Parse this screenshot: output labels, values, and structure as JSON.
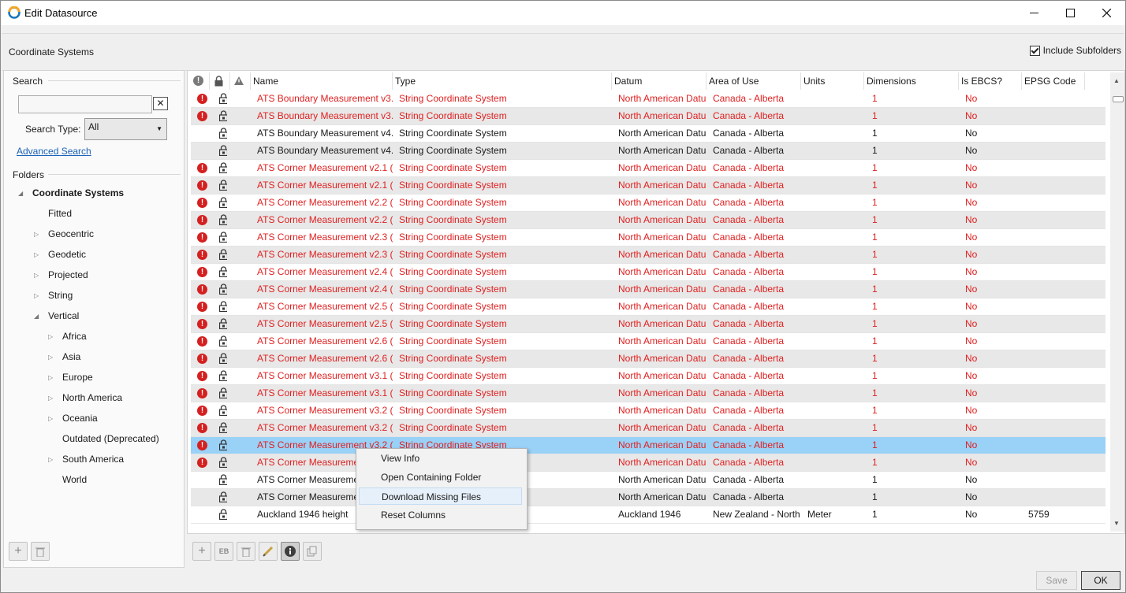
{
  "window": {
    "title": "Edit Datasource"
  },
  "header": {
    "section_title": "Coordinate Systems",
    "include_subfolders": "Include Subfolders",
    "include_subfolders_checked": true
  },
  "search": {
    "label": "Search",
    "type_label": "Search Type:",
    "type_value": "All",
    "advanced": "Advanced Search",
    "clear": "✕"
  },
  "folders": {
    "label": "Folders",
    "items": [
      {
        "label": "Coordinate Systems",
        "level": 0,
        "expander": "open",
        "bold": true
      },
      {
        "label": "Fitted",
        "level": 1,
        "expander": "none"
      },
      {
        "label": "Geocentric",
        "level": 1,
        "expander": "closed"
      },
      {
        "label": "Geodetic",
        "level": 1,
        "expander": "closed"
      },
      {
        "label": "Projected",
        "level": 1,
        "expander": "closed"
      },
      {
        "label": "String",
        "level": 1,
        "expander": "closed"
      },
      {
        "label": "Vertical",
        "level": 1,
        "expander": "open"
      },
      {
        "label": "Africa",
        "level": 2,
        "expander": "closed"
      },
      {
        "label": "Asia",
        "level": 2,
        "expander": "closed"
      },
      {
        "label": "Europe",
        "level": 2,
        "expander": "closed"
      },
      {
        "label": "North America",
        "level": 2,
        "expander": "closed"
      },
      {
        "label": "Oceania",
        "level": 2,
        "expander": "closed"
      },
      {
        "label": "Outdated (Deprecated)",
        "level": 2,
        "expander": "none"
      },
      {
        "label": "South America",
        "level": 2,
        "expander": "closed"
      },
      {
        "label": "World",
        "level": 2,
        "expander": "none"
      }
    ]
  },
  "grid": {
    "columns": [
      "Name",
      "Type",
      "Datum",
      "Area of Use",
      "Units",
      "Dimensions",
      "Is EBCS?",
      "EPSG Code"
    ],
    "rows": [
      {
        "err": true,
        "name": "ATS Boundary Measurement v3.",
        "type": "String Coordinate System",
        "datum": "North American Datu",
        "area": "Canada - Alberta",
        "units": "",
        "dims": "1",
        "ebcs": "No",
        "epsg": ""
      },
      {
        "err": true,
        "name": "ATS Boundary Measurement v3.",
        "type": "String Coordinate System",
        "datum": "North American Datu",
        "area": "Canada - Alberta",
        "units": "",
        "dims": "1",
        "ebcs": "No",
        "epsg": ""
      },
      {
        "err": false,
        "name": "ATS Boundary Measurement v4.",
        "type": "String Coordinate System",
        "datum": "North American Datu",
        "area": "Canada - Alberta",
        "units": "",
        "dims": "1",
        "ebcs": "No",
        "epsg": ""
      },
      {
        "err": false,
        "name": "ATS Boundary Measurement v4.",
        "type": "String Coordinate System",
        "datum": "North American Datu",
        "area": "Canada - Alberta",
        "units": "",
        "dims": "1",
        "ebcs": "No",
        "epsg": ""
      },
      {
        "err": true,
        "name": "ATS Corner Measurement v2.1 (I",
        "type": "String Coordinate System",
        "datum": "North American Datu",
        "area": "Canada - Alberta",
        "units": "",
        "dims": "1",
        "ebcs": "No",
        "epsg": ""
      },
      {
        "err": true,
        "name": "ATS Corner Measurement v2.1 (I",
        "type": "String Coordinate System",
        "datum": "North American Datu",
        "area": "Canada - Alberta",
        "units": "",
        "dims": "1",
        "ebcs": "No",
        "epsg": ""
      },
      {
        "err": true,
        "name": "ATS Corner Measurement v2.2 (I",
        "type": "String Coordinate System",
        "datum": "North American Datu",
        "area": "Canada - Alberta",
        "units": "",
        "dims": "1",
        "ebcs": "No",
        "epsg": ""
      },
      {
        "err": true,
        "name": "ATS Corner Measurement v2.2 (I",
        "type": "String Coordinate System",
        "datum": "North American Datu",
        "area": "Canada - Alberta",
        "units": "",
        "dims": "1",
        "ebcs": "No",
        "epsg": ""
      },
      {
        "err": true,
        "name": "ATS Corner Measurement v2.3 (I",
        "type": "String Coordinate System",
        "datum": "North American Datu",
        "area": "Canada - Alberta",
        "units": "",
        "dims": "1",
        "ebcs": "No",
        "epsg": ""
      },
      {
        "err": true,
        "name": "ATS Corner Measurement v2.3 (I",
        "type": "String Coordinate System",
        "datum": "North American Datu",
        "area": "Canada - Alberta",
        "units": "",
        "dims": "1",
        "ebcs": "No",
        "epsg": ""
      },
      {
        "err": true,
        "name": "ATS Corner Measurement v2.4 (I",
        "type": "String Coordinate System",
        "datum": "North American Datu",
        "area": "Canada - Alberta",
        "units": "",
        "dims": "1",
        "ebcs": "No",
        "epsg": ""
      },
      {
        "err": true,
        "name": "ATS Corner Measurement v2.4 (I",
        "type": "String Coordinate System",
        "datum": "North American Datu",
        "area": "Canada - Alberta",
        "units": "",
        "dims": "1",
        "ebcs": "No",
        "epsg": ""
      },
      {
        "err": true,
        "name": "ATS Corner Measurement v2.5 (I",
        "type": "String Coordinate System",
        "datum": "North American Datu",
        "area": "Canada - Alberta",
        "units": "",
        "dims": "1",
        "ebcs": "No",
        "epsg": ""
      },
      {
        "err": true,
        "name": "ATS Corner Measurement v2.5 (I",
        "type": "String Coordinate System",
        "datum": "North American Datu",
        "area": "Canada - Alberta",
        "units": "",
        "dims": "1",
        "ebcs": "No",
        "epsg": ""
      },
      {
        "err": true,
        "name": "ATS Corner Measurement v2.6 (I",
        "type": "String Coordinate System",
        "datum": "North American Datu",
        "area": "Canada - Alberta",
        "units": "",
        "dims": "1",
        "ebcs": "No",
        "epsg": ""
      },
      {
        "err": true,
        "name": "ATS Corner Measurement v2.6 (I",
        "type": "String Coordinate System",
        "datum": "North American Datu",
        "area": "Canada - Alberta",
        "units": "",
        "dims": "1",
        "ebcs": "No",
        "epsg": ""
      },
      {
        "err": true,
        "name": "ATS Corner Measurement v3.1 (I",
        "type": "String Coordinate System",
        "datum": "North American Datu",
        "area": "Canada - Alberta",
        "units": "",
        "dims": "1",
        "ebcs": "No",
        "epsg": ""
      },
      {
        "err": true,
        "name": "ATS Corner Measurement v3.1 (I",
        "type": "String Coordinate System",
        "datum": "North American Datu",
        "area": "Canada - Alberta",
        "units": "",
        "dims": "1",
        "ebcs": "No",
        "epsg": ""
      },
      {
        "err": true,
        "name": "ATS Corner Measurement v3.2 (I",
        "type": "String Coordinate System",
        "datum": "North American Datu",
        "area": "Canada - Alberta",
        "units": "",
        "dims": "1",
        "ebcs": "No",
        "epsg": ""
      },
      {
        "err": true,
        "name": "ATS Corner Measurement v3.2 (I",
        "type": "String Coordinate System",
        "datum": "North American Datu",
        "area": "Canada - Alberta",
        "units": "",
        "dims": "1",
        "ebcs": "No",
        "epsg": ""
      },
      {
        "err": true,
        "selected": true,
        "name": "ATS Corner Measurement v3.2 (I",
        "type": "String Coordinate System",
        "datum": "North American Datu",
        "area": "Canada - Alberta",
        "units": "",
        "dims": "1",
        "ebcs": "No",
        "epsg": ""
      },
      {
        "err": true,
        "name": "ATS Corner Measureme",
        "type": "",
        "datum": "North American Datu",
        "area": "Canada - Alberta",
        "units": "",
        "dims": "1",
        "ebcs": "No",
        "epsg": ""
      },
      {
        "err": false,
        "name": "ATS Corner Measureme",
        "type": "",
        "datum": "North American Datu",
        "area": "Canada - Alberta",
        "units": "",
        "dims": "1",
        "ebcs": "No",
        "epsg": ""
      },
      {
        "err": false,
        "name": "ATS Corner Measureme",
        "type": "",
        "datum": "North American Datu",
        "area": "Canada - Alberta",
        "units": "",
        "dims": "1",
        "ebcs": "No",
        "epsg": ""
      },
      {
        "err": false,
        "name": "Auckland 1946 height",
        "type": "",
        "datum": "Auckland 1946",
        "area": "New Zealand - North",
        "units": "Meter",
        "dims": "1",
        "ebcs": "No",
        "epsg": "5759"
      }
    ]
  },
  "context_menu": {
    "items": [
      "View Info",
      "Open Containing Folder",
      "Download Missing Files",
      "Reset Columns"
    ],
    "hover_index": 2
  },
  "footer": {
    "save": "Save",
    "ok": "OK",
    "eb": "EB"
  },
  "colors": {
    "error_text": "#e02020",
    "selected_row": "#99d1f7",
    "link": "#1c63b7"
  }
}
